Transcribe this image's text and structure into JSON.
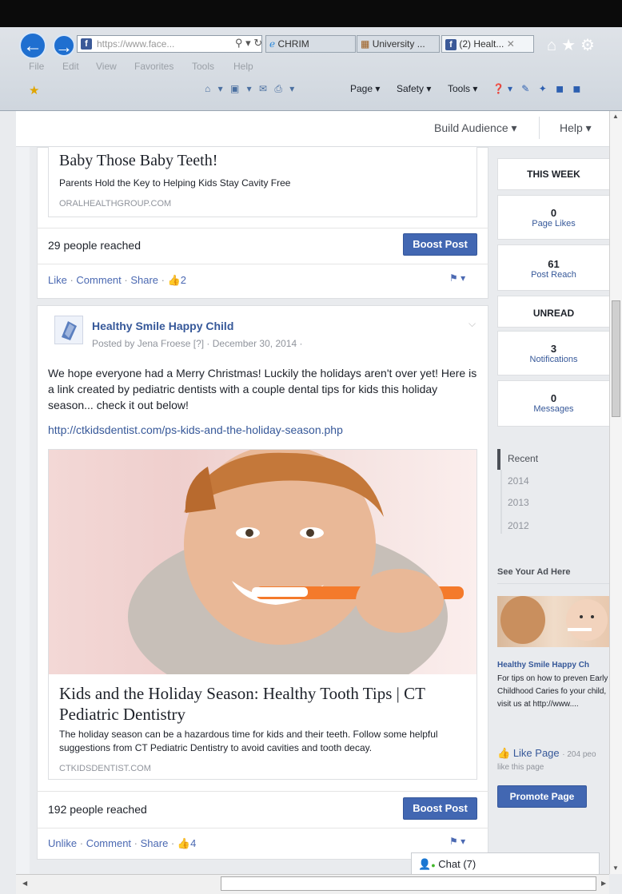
{
  "browser": {
    "address_text": "https://www.face...",
    "tabs": [
      {
        "label": "CHRIM"
      },
      {
        "label": "University ..."
      },
      {
        "label": "(2) Healt..."
      }
    ],
    "menus": [
      "File",
      "Edit",
      "View",
      "Favorites",
      "Tools",
      "Help"
    ],
    "toolbar": {
      "page": "Page ▾",
      "safety": "Safety ▾",
      "tools": "Tools ▾"
    }
  },
  "fb_header": {
    "build_audience": "Build Audience ▾",
    "help": "Help ▾"
  },
  "post1": {
    "link_title": "Baby Those Baby Teeth!",
    "link_desc": "Parents Hold the Key to Helping Kids Stay Cavity Free",
    "link_domain": "ORALHEALTHGROUP.COM",
    "reached": "29 people reached",
    "boost": "Boost Post",
    "like": "Like",
    "comment": "Comment",
    "share": "Share",
    "likes": "2"
  },
  "post2": {
    "page_name": "Healthy Smile Happy Child",
    "meta": "Posted by Jena Froese [?] · December 30, 2014 ·",
    "text": "We hope everyone had a Merry Christmas! Luckily the holidays aren't over yet! Here is a link created by pediatric dentists with a couple dental tips for kids this holiday season... check it out below!",
    "url": "http://ctkidsdentist.com/ps-kids-and-the-holiday-season.php",
    "link_title": "Kids and the Holiday Season: Healthy Tooth Tips | CT Pediatric Dentistry",
    "link_desc": "The holiday season can be a hazardous time for kids and their teeth. Follow some helpful suggestions from CT Pediatric Dentistry to avoid cavities and tooth decay.",
    "link_domain": "CTKIDSDENTIST.COM",
    "reached": "192 people reached",
    "boost": "Boost Post",
    "unlike": "Unlike",
    "comment": "Comment",
    "share": "Share",
    "likes": "4"
  },
  "rail": {
    "this_week": "THIS WEEK",
    "page_likes_num": "0",
    "page_likes_lbl": "Page Likes",
    "post_reach_num": "61",
    "post_reach_lbl": "Post Reach",
    "unread": "UNREAD",
    "notif_num": "3",
    "notif_lbl": "Notifications",
    "msg_num": "0",
    "msg_lbl": "Messages",
    "years": [
      "Recent",
      "2014",
      "2013",
      "2012"
    ],
    "ad_header": "See Your Ad Here",
    "ad_title": "Healthy Smile Happy Ch",
    "ad_text": "For tips on how to preven Early Childhood Caries fo your child, visit us at http://www....",
    "like_page": "Like Page",
    "like_count": "· 204 peo",
    "like_this": "like this page",
    "promote": "Promote Page"
  },
  "chat": {
    "label": "Chat (7)"
  }
}
